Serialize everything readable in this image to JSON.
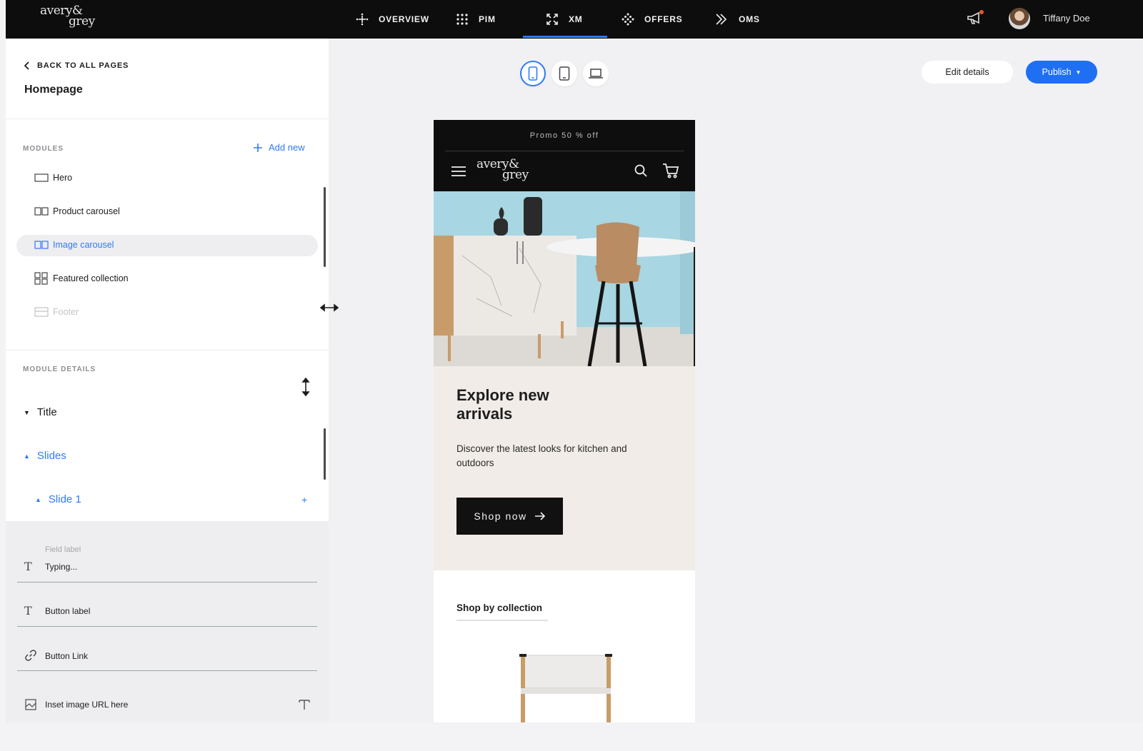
{
  "app": {
    "brand": {
      "line1": "avery&",
      "line2": "grey"
    },
    "nav": [
      {
        "label": "OVERVIEW",
        "icon": "move-icon"
      },
      {
        "label": "PIM",
        "icon": "grid-dots-icon"
      },
      {
        "label": "XM",
        "icon": "expand-arrows-icon",
        "active": true
      },
      {
        "label": "OFFERS",
        "icon": "diamond-dots-icon"
      },
      {
        "label": "OMS",
        "icon": "chevrons-right-icon"
      }
    ],
    "user": {
      "name": "Tiffany Doe"
    },
    "accent": "#2f7bf5"
  },
  "sidebar": {
    "back_label": "BACK TO ALL PAGES",
    "page_title": "Homepage",
    "modules_label": "MODULES",
    "add_new_label": "Add new",
    "modules": [
      {
        "label": "Hero",
        "icon": "hero-module-icon",
        "state": "normal"
      },
      {
        "label": "Product carousel",
        "icon": "carousel-module-icon",
        "state": "normal"
      },
      {
        "label": "Image carousel",
        "icon": "carousel-module-icon",
        "state": "active"
      },
      {
        "label": "Featured collection",
        "icon": "grid-module-icon",
        "state": "normal"
      },
      {
        "label": "Footer",
        "icon": "footer-module-icon",
        "state": "muted"
      }
    ],
    "details_label": "MODULE DETAILS",
    "tree": [
      {
        "label": "Title",
        "expanded": false
      },
      {
        "label": "Slides",
        "expanded": true
      },
      {
        "label": "Slide 1",
        "expanded": true
      }
    ],
    "fields": [
      {
        "label": "Field label",
        "value": "Typing...",
        "icon": "text-icon"
      },
      {
        "label": "",
        "value": "Button label",
        "icon": "text-icon"
      },
      {
        "label": "",
        "value": "Button Link",
        "icon": "link-icon"
      },
      {
        "label": "",
        "value": "Inset image URL here",
        "icon": "image-icon"
      }
    ]
  },
  "toolbar": {
    "devices": [
      "mobile",
      "tablet",
      "desktop"
    ],
    "active_device": "mobile",
    "edit_label": "Edit details",
    "publish_label": "Publish"
  },
  "preview": {
    "promo": "Promo 50 % off",
    "hero_title": "Explore new arrivals",
    "hero_desc": "Discover the latest looks for kitchen and outdoors",
    "cta_label": "Shop now",
    "collection_title": "Shop by collection"
  }
}
